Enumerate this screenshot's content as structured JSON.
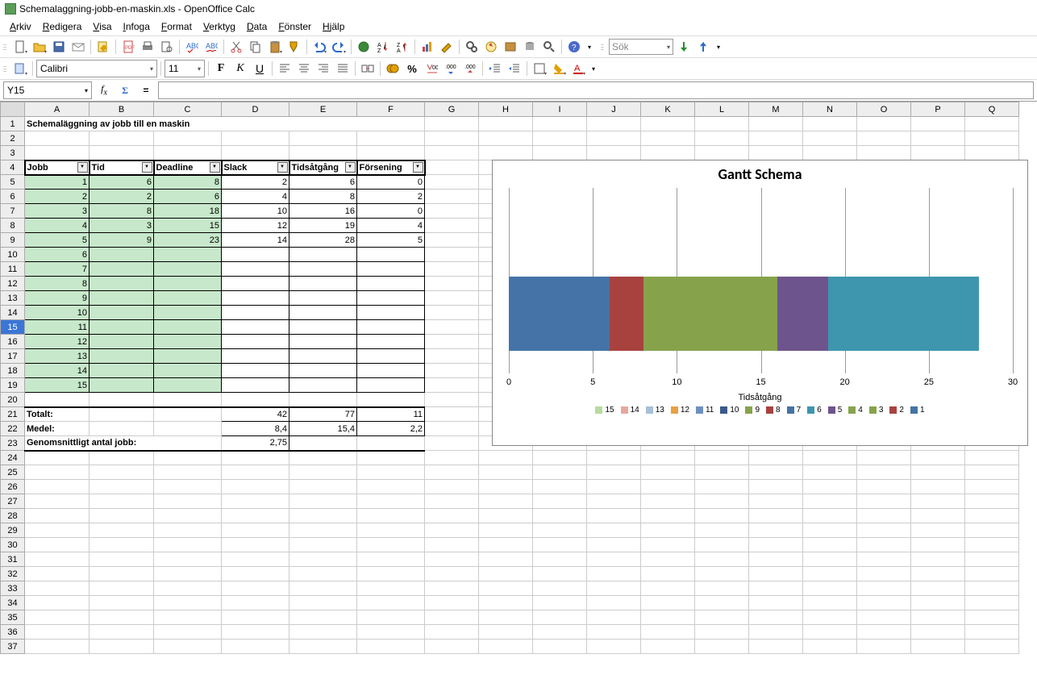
{
  "window": {
    "title": "Schemalaggning-jobb-en-maskin.xls - OpenOffice Calc"
  },
  "menu": [
    "Arkiv",
    "Redigera",
    "Visa",
    "Infoga",
    "Format",
    "Verktyg",
    "Data",
    "Fönster",
    "Hjälp"
  ],
  "toolbar2": {
    "font": "Calibri",
    "size": "11"
  },
  "namebox": "Y15",
  "search_placeholder": "Sök",
  "sheet": {
    "title": "Schemaläggning av jobb till en maskin",
    "headers": [
      "Jobb",
      "Tid",
      "Deadline",
      "Slack",
      "Tidsåtgång",
      "Försening"
    ],
    "rows": [
      {
        "j": 1,
        "t": 6,
        "d": 8,
        "s": 2,
        "ta": 6,
        "f": 0
      },
      {
        "j": 2,
        "t": 2,
        "d": 6,
        "s": 4,
        "ta": 8,
        "f": 2
      },
      {
        "j": 3,
        "t": 8,
        "d": 18,
        "s": 10,
        "ta": 16,
        "f": 0
      },
      {
        "j": 4,
        "t": 3,
        "d": 15,
        "s": 12,
        "ta": 19,
        "f": 4
      },
      {
        "j": 5,
        "t": 9,
        "d": 23,
        "s": 14,
        "ta": 28,
        "f": 5
      },
      {
        "j": 6
      },
      {
        "j": 7
      },
      {
        "j": 8
      },
      {
        "j": 9
      },
      {
        "j": 10
      },
      {
        "j": 11
      },
      {
        "j": 12
      },
      {
        "j": 13
      },
      {
        "j": 14
      },
      {
        "j": 15
      }
    ],
    "summary": {
      "total_label": "Totalt:",
      "total": {
        "s": "42",
        "ta": "77",
        "f": "11"
      },
      "mean_label": "Medel:",
      "mean": {
        "s": "8,4",
        "ta": "15,4",
        "f": "2,2"
      },
      "avg_label": "Genomsnittligt antal jobb:",
      "avg": "2,75"
    }
  },
  "columns": [
    "A",
    "B",
    "C",
    "D",
    "E",
    "F",
    "G",
    "H",
    "I",
    "J",
    "K",
    "L",
    "M",
    "N",
    "O",
    "P",
    "Q"
  ],
  "row_numbers_max": 37,
  "selected_row": 15,
  "chart_data": {
    "type": "bar",
    "title": "Gantt Schema",
    "xlabel": "Tidsåtgång",
    "xlim": [
      0,
      30
    ],
    "ticks": [
      0,
      5,
      10,
      15,
      20,
      25,
      30
    ],
    "series": [
      {
        "name": "1",
        "start": 0,
        "len": 6,
        "color": "#4573a7"
      },
      {
        "name": "2",
        "start": 6,
        "len": 2,
        "color": "#a8423f"
      },
      {
        "name": "3",
        "start": 8,
        "len": 8,
        "color": "#86a34b"
      },
      {
        "name": "4",
        "start": 16,
        "len": 3,
        "color": "#6e548d"
      },
      {
        "name": "5",
        "start": 19,
        "len": 9,
        "color": "#3d96ae"
      }
    ],
    "legend": [
      {
        "n": "15",
        "c": "#b7dba0"
      },
      {
        "n": "14",
        "c": "#e8a8a0"
      },
      {
        "n": "13",
        "c": "#a8c0d8"
      },
      {
        "n": "12",
        "c": "#e8a040"
      },
      {
        "n": "11",
        "c": "#6e90c0"
      },
      {
        "n": "10",
        "c": "#3a5a8a"
      },
      {
        "n": "9",
        "c": "#86a34b"
      },
      {
        "n": "8",
        "c": "#a8423f"
      },
      {
        "n": "7",
        "c": "#4573a7"
      },
      {
        "n": "6",
        "c": "#3d96ae"
      },
      {
        "n": "5",
        "c": "#6e548d"
      },
      {
        "n": "4",
        "c": "#86a34b"
      },
      {
        "n": "3",
        "c": "#86a34b"
      },
      {
        "n": "2",
        "c": "#a8423f"
      },
      {
        "n": "1",
        "c": "#4573a7"
      }
    ]
  }
}
